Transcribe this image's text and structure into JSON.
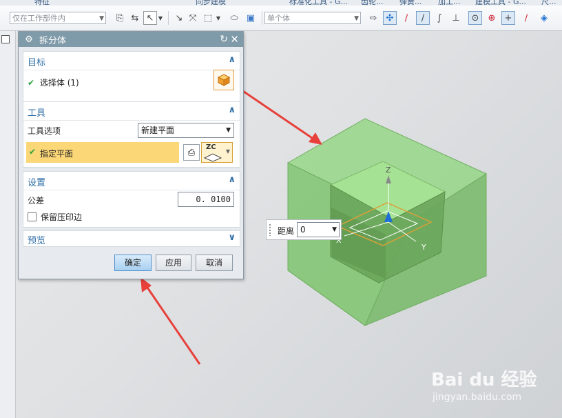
{
  "toolbar": {
    "filter_combo": "仅在工作部件内",
    "type_combo": "单个体",
    "ribbon_tabs": [
      "特征",
      "同步建模",
      "标准化工具 - G...",
      "齿轮...",
      "弹簧...",
      "加工...",
      "建模工具 - G...",
      "尺..."
    ]
  },
  "dialog": {
    "title": "拆分体",
    "target": {
      "header": "目标",
      "select_body": "选择体 (1)"
    },
    "tool": {
      "header": "工具",
      "option_label": "工具选项",
      "option_value": "新建平面",
      "specify_plane": "指定平面",
      "zc_label": "ZC"
    },
    "settings": {
      "header": "设置",
      "tolerance_label": "公差",
      "tolerance_value": "0. 0100",
      "keep_imprint": "保留压印边"
    },
    "preview": {
      "header": "预览"
    },
    "buttons": {
      "ok": "确定",
      "apply": "应用",
      "cancel": "取消"
    }
  },
  "viewport": {
    "distance_label": "距离",
    "distance_value": "0",
    "axis_z": "Z",
    "axis_x": "X",
    "axis_y": "Y"
  },
  "watermark": {
    "brand": "Bai du 经验",
    "url": "jingyan.baidu.com"
  },
  "colors": {
    "dialog_title": "#7f9aa8",
    "section_header": "#2f6ea6",
    "highlight": "#fcd777",
    "body_green": "#7fc46f",
    "arrow_red": "#e8403a"
  }
}
